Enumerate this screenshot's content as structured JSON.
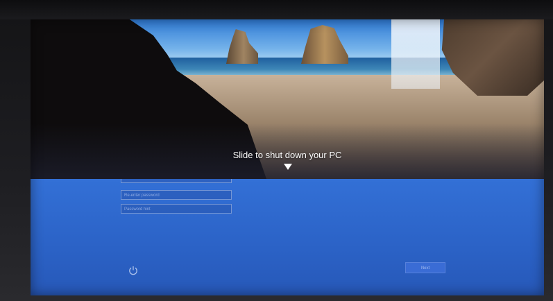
{
  "lock_screen": {
    "shutdown_prompt": "Slide to shut down your PC",
    "arrow_icon": "triangle-down-icon"
  },
  "login_form": {
    "fields": [
      {
        "placeholder": ""
      },
      {
        "placeholder": "Re-enter password"
      },
      {
        "placeholder": "Password hint"
      }
    ],
    "next_label": "Next",
    "power_icon": "power-icon"
  },
  "colors": {
    "login_background": "#2b62c6",
    "prompt_text": "#ffffff"
  }
}
